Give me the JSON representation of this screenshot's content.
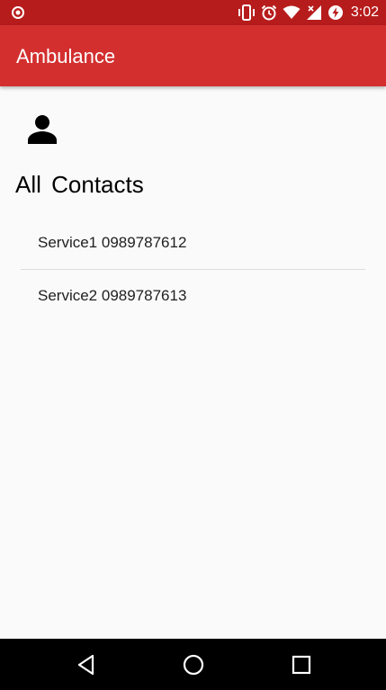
{
  "status_bar": {
    "time": "3:02",
    "icons": [
      "notification-target-icon",
      "vibrate-icon",
      "alarm-icon",
      "wifi-icon",
      "cell-signal-icon",
      "battery-charging-icon"
    ],
    "color": "#b71c1c"
  },
  "app_bar": {
    "title": "Ambulance",
    "color": "#d32f2f"
  },
  "main": {
    "header_icon": "person-icon",
    "section_title": "All  Contacts",
    "contacts": [
      {
        "text": "Service1 0989787612"
      },
      {
        "text": "Service2 0989787613"
      }
    ]
  },
  "nav_bar": {
    "icons": [
      "back-icon",
      "home-icon",
      "recents-icon"
    ]
  }
}
